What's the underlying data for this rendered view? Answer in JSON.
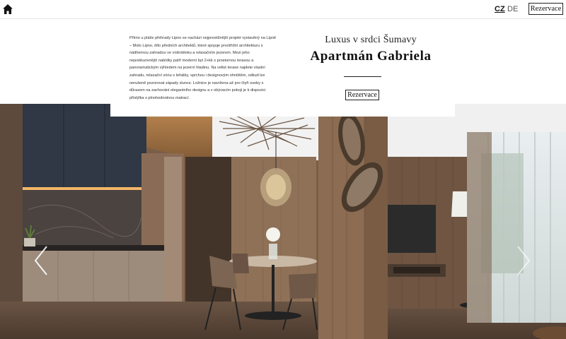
{
  "header": {
    "home_icon": "home-icon",
    "languages": [
      {
        "code": "CZ",
        "active": true
      },
      {
        "code": "DE",
        "active": false
      }
    ],
    "reservation_label": "Rezervace"
  },
  "intro": {
    "description": "Přímo u pláže přehrady Lipno se nachází nejprestižnější projekt vystavěný na Lipně – Molo Lipno, dílo předních architektů, které spojuje prvotřídní architekturu s nádhernou zahradou ve vnitrobloku a relaxačním jezerem. Mezi jeho nejexkluzivnější nabídky patří moderní byt 2+kk s prostornou terasou a panoramatickým výhledem na jezerní hladinu. Na velké terase najdete vlastní zahradu, relaxační zónu s lehátky, sprchou i designovým ohništěm, odkud lze nerušeně pozorovat západy slunce. Ložnice je navržena až pro čtyři osoby s důrazem na zachování elegantního designu a v obývacím pokoji je k dispozici přistýlka s plnohodnotnou matrací.",
    "subtitle": "Luxus v srdci Šumavy",
    "title": "Apartmán Gabriela",
    "reservation_label": "Rezervace"
  },
  "slider": {
    "prev_icon": "chevron-left-icon",
    "next_icon": "chevron-right-icon"
  },
  "colors": {
    "accent": "#111111",
    "wood": "#8a6a4c",
    "cabinet": "#2f3844"
  }
}
